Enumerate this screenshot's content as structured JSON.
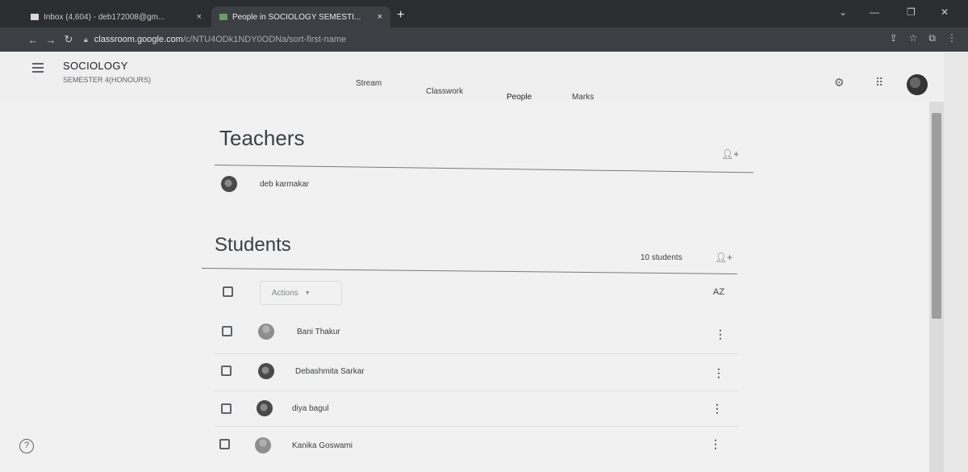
{
  "browser": {
    "tabs": [
      {
        "title": "Inbox (4,604) - deb172008@gm...",
        "close": "×",
        "active": false
      },
      {
        "title": "People in SOCIOLOGY SEMESTI...",
        "close": "×",
        "active": true
      }
    ],
    "new_tab": "+",
    "url_host": "classroom.google.com",
    "url_path": "/c/NTU4ODk1NDY0ODNa/sort-first-name",
    "nav_icons": [
      "arrow-left-icon",
      "arrow-right-icon",
      "reload-icon"
    ]
  },
  "header": {
    "class_name": "SOCIOLOGY",
    "section": "SEMESTER 4(HONOURS)",
    "tabs": [
      {
        "label": "Stream",
        "active": false
      },
      {
        "label": "Classwork",
        "active": false
      },
      {
        "label": "People",
        "active": true
      },
      {
        "label": "Marks",
        "active": false
      }
    ],
    "icons": [
      "settings-icon",
      "apps-grid-icon",
      "account-avatar"
    ]
  },
  "teachers": {
    "title": "Teachers",
    "list": [
      {
        "name": "deb karmakar"
      }
    ]
  },
  "students": {
    "title": "Students",
    "count": "10 students",
    "actions_label": "Actions",
    "sort_label": "AZ",
    "list": [
      {
        "name": "Bani Thakur",
        "avatar": "default"
      },
      {
        "name": "Debashmita Sarkar",
        "avatar": "photo"
      },
      {
        "name": "diya bagul",
        "avatar": "photo"
      },
      {
        "name": "Kanika Goswami",
        "avatar": "default"
      }
    ]
  },
  "help": {
    "symbol": "?"
  }
}
